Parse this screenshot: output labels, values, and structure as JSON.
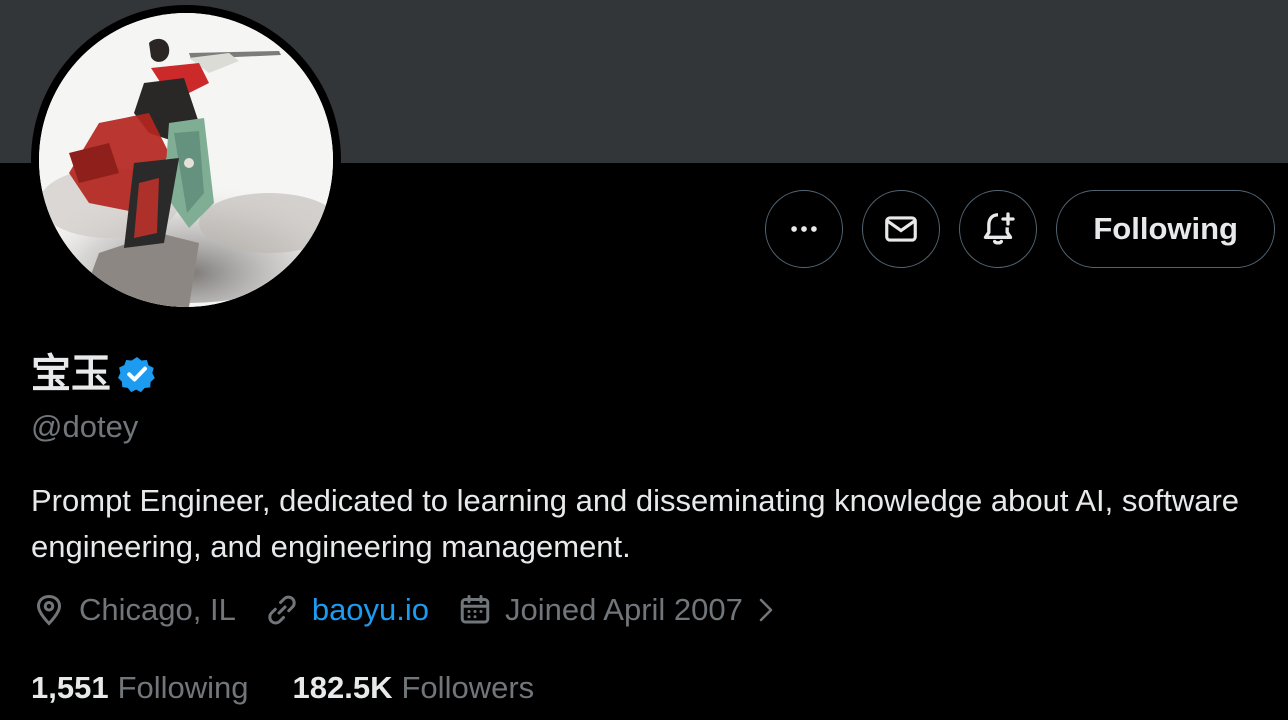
{
  "profile": {
    "display_name": "宝玉",
    "handle": "@dotey",
    "verified": true,
    "bio": "Prompt Engineer, dedicated to learning and disseminating knowledge about AI, software engineering, and engineering management.",
    "location": "Chicago, IL",
    "website": "baoyu.io",
    "joined": "Joined April 2007"
  },
  "actions": {
    "more_icon": "more-icon",
    "message_icon": "mail-icon",
    "notify_icon": "bell-plus-icon",
    "follow_label": "Following"
  },
  "stats": {
    "following_count": "1,551",
    "following_label": "Following",
    "followers_count": "182.5K",
    "followers_label": "Followers"
  },
  "colors": {
    "background": "#000000",
    "banner": "#333639",
    "text_primary": "#e7e9ea",
    "text_secondary": "#71767b",
    "link": "#1d9bf0",
    "verified_badge": "#1d9bf0",
    "button_border": "#536471"
  }
}
